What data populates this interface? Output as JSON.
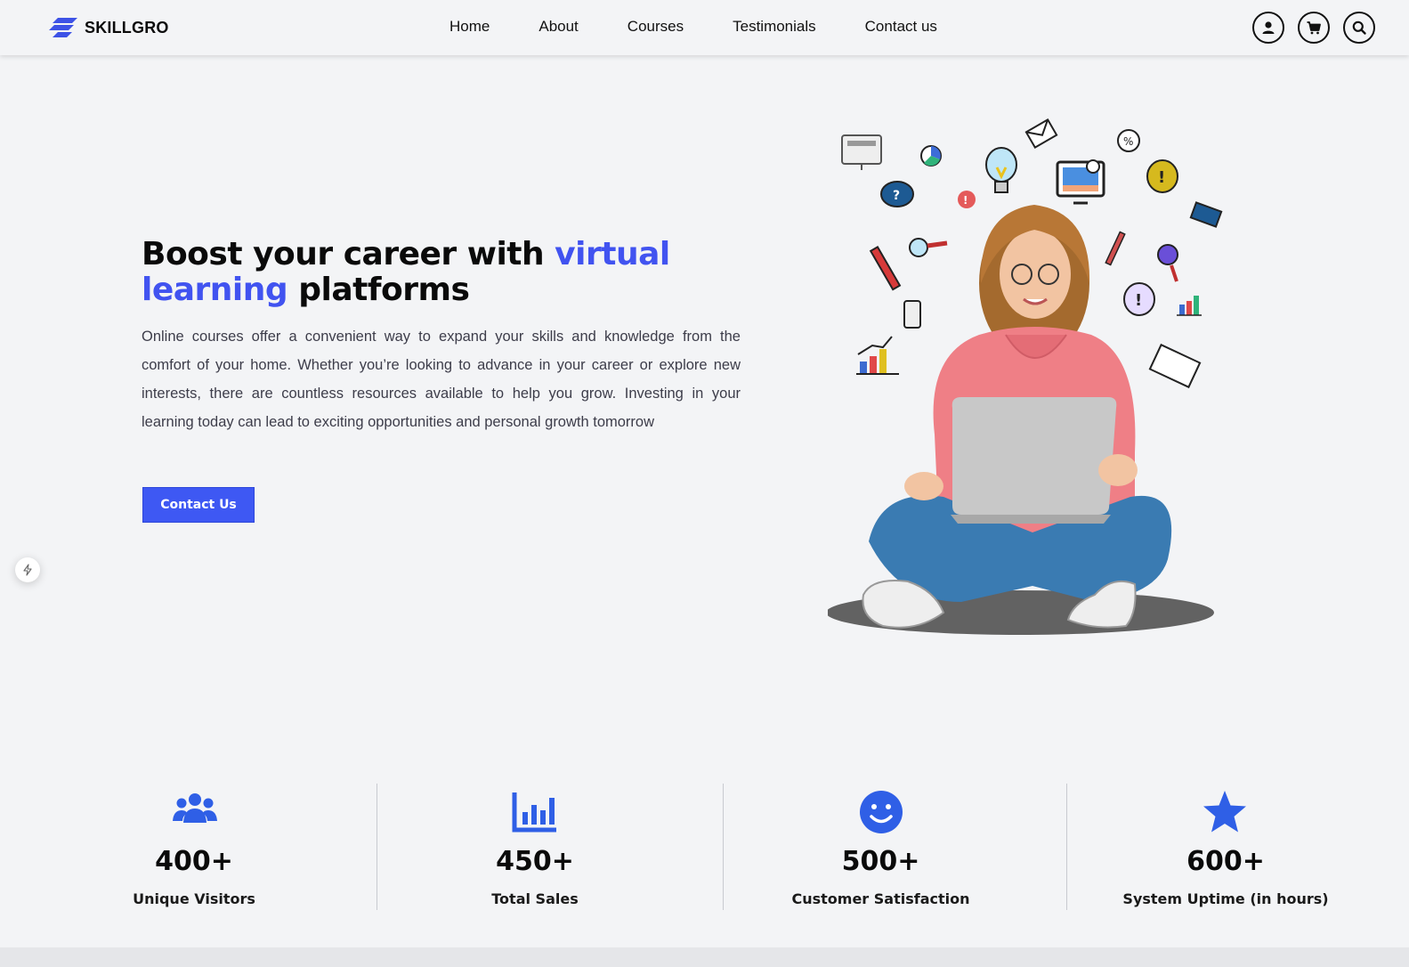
{
  "header": {
    "brand": "SKILLGRO",
    "nav": [
      "Home",
      "About",
      "Courses",
      "Testimonials",
      "Contact us"
    ],
    "icons": [
      "user-icon",
      "cart-icon",
      "search-icon"
    ]
  },
  "hero": {
    "title_part1": "Boost your career with ",
    "title_accent": "virtual learning",
    "title_part2": " platforms",
    "description": "Online courses offer a convenient way to expand your skills and knowledge from the comfort of your home. Whether you’re looking to advance in your career or explore new interests, there are countless resources available to help you grow. Investing in your learning today can lead to exciting opportunities and personal growth tomorrow",
    "cta_label": "Contact Us"
  },
  "stats": [
    {
      "icon": "users-icon",
      "value": "400+",
      "label": "Unique Visitors"
    },
    {
      "icon": "bar-chart-icon",
      "value": "450+",
      "label": "Total Sales"
    },
    {
      "icon": "smile-icon",
      "value": "500+",
      "label": "Customer Satisfaction"
    },
    {
      "icon": "star-icon",
      "value": "600+",
      "label": "System Uptime (in hours)"
    }
  ],
  "colors": {
    "accent": "#4153f0",
    "button": "#3e58f3",
    "stat_icon": "#2f5fe6",
    "background": "#f3f4f6"
  }
}
